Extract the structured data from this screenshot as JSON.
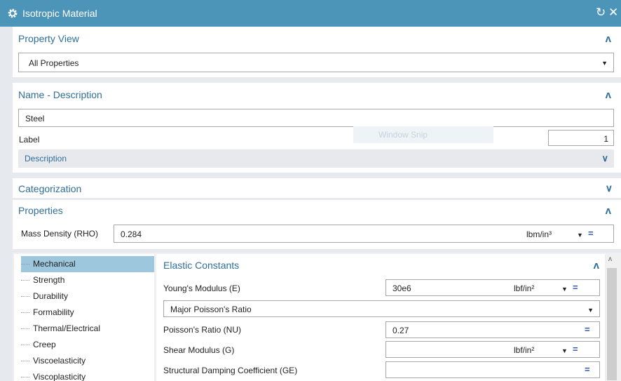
{
  "window": {
    "title": "Isotropic Material",
    "reset_icon": "reset-icon",
    "close_icon": "close-icon"
  },
  "property_view": {
    "title": "Property View",
    "selected": "All Properties"
  },
  "name_description": {
    "title": "Name - Description",
    "name_value": "Steel",
    "label_text": "Label",
    "label_value": "1",
    "description_label": "Description",
    "overlay_text": "Window Snip"
  },
  "categorization": {
    "title": "Categorization"
  },
  "properties": {
    "title": "Properties",
    "mass_density_label": "Mass Density (RHO)",
    "mass_density_value": "0.284",
    "mass_density_unit": "lbm/in³"
  },
  "tree": {
    "items": [
      "Mechanical",
      "Strength",
      "Durability",
      "Formability",
      "Thermal/Electrical",
      "Creep",
      "Viscoelasticity",
      "Viscoplasticity"
    ],
    "selected": "Mechanical"
  },
  "elastic": {
    "title": "Elastic Constants",
    "youngs_label": "Young's Modulus (E)",
    "youngs_value": "30e6",
    "youngs_unit": "lbf/in²",
    "poisson_mode": "Major Poisson's Ratio",
    "poisson_label": "Poisson's Ratio (NU)",
    "poisson_value": "0.27",
    "shear_label": "Shear Modulus (G)",
    "shear_value": "",
    "shear_unit": "lbf/in²",
    "damping_label": "Structural Damping Coefficient (GE)",
    "damping_value": ""
  },
  "colors": {
    "titlebar": "#4c94b8",
    "accent": "#2f6f9a",
    "selection": "#9cc7dc"
  }
}
